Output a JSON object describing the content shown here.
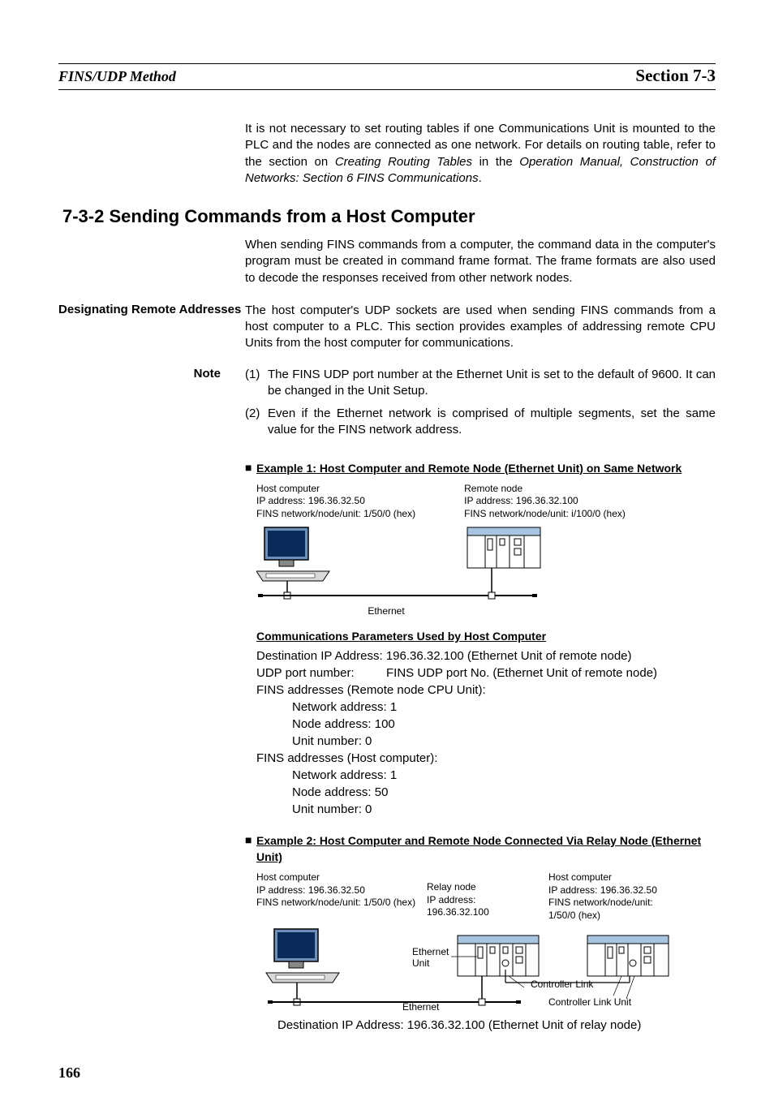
{
  "header": {
    "left": "FINS/UDP Method",
    "right": "Section 7-3"
  },
  "intro_para_pre": "It is not necessary to set routing tables if one Communications Unit is mounted to the PLC and the nodes are connected as one network. For details on routing table, refer to the section on ",
  "intro_italic1": "Creating Routing Tables",
  "intro_mid": " in the ",
  "intro_italic2": "Operation Manual, Construction of Networks: Section 6 FINS Communications",
  "intro_end": ".",
  "section_heading": "7-3-2    Sending Commands from a Host Computer",
  "section_para": "When sending FINS commands from a computer, the command data in the computer's program must be created in command frame format. The frame formats are also used to decode the responses received from other network nodes.",
  "sidebar": {
    "designating": "Designating Remote Addresses"
  },
  "designating_para": "The host computer's UDP sockets are used when sending FINS commands from a host computer to a PLC. This section provides examples of addressing remote CPU Units from the host computer for communications.",
  "note_label": "Note",
  "notes": [
    {
      "num": "(1)",
      "text": "The FINS UDP port number at the Ethernet Unit is set to the default of 9600. It can be changed in the Unit Setup."
    },
    {
      "num": "(2)",
      "text": "Even if the Ethernet network is comprised of multiple segments, set the same value for the FINS network address."
    }
  ],
  "ex1": {
    "title": "Example 1: Host Computer and Remote Node (Ethernet Unit) on Same Network",
    "host": {
      "l1": "Host computer",
      "l2": "IP address: 196.36.32.50",
      "l3": "FINS network/node/unit: 1/50/0 (hex)"
    },
    "remote": {
      "l1": "Remote node",
      "l2": "IP address: 196.36.32.100",
      "l3": "FINS network/node/unit: i/100/0 (hex)"
    },
    "ethernet": "Ethernet"
  },
  "comm_title": "Communications Parameters Used by Host Computer",
  "comm": {
    "l1": "Destination IP Address: 196.36.32.100 (Ethernet Unit of remote node)",
    "l2a": "UDP port number:",
    "l2b": "FINS UDP port No. (Ethernet Unit of remote node)",
    "l3": "FINS addresses (Remote node CPU Unit):",
    "l4": "Network address: 1",
    "l5": "Node address: 100",
    "l6": "Unit number: 0",
    "l7": "FINS addresses (Host computer):",
    "l8": "Network address: 1",
    "l9": "Node address: 50",
    "l10": "Unit number: 0"
  },
  "ex2": {
    "title": "Example 2: Host Computer and Remote Node Connected Via Relay Node (Ethernet Unit)",
    "host": {
      "l1": "Host computer",
      "l2": "IP address: 196.36.32.50",
      "l3": "FINS network/node/unit: 1/50/0 (hex)"
    },
    "relay": {
      "l1": "Relay node",
      "l2": "IP address:",
      "l3": "196.36.32.100"
    },
    "host2": {
      "l1": "Host computer",
      "l2": "IP address: 196.36.32.50",
      "l3": "FINS network/node/unit:",
      "l4": "1/50/0 (hex)"
    },
    "eth_unit": "Ethernet Unit",
    "ethernet": "Ethernet",
    "clink": "Controller Link",
    "clink_unit": "Controller Link Unit",
    "dest": "Destination IP Address: 196.36.32.100 (Ethernet Unit of relay node)"
  },
  "page_number": "166"
}
